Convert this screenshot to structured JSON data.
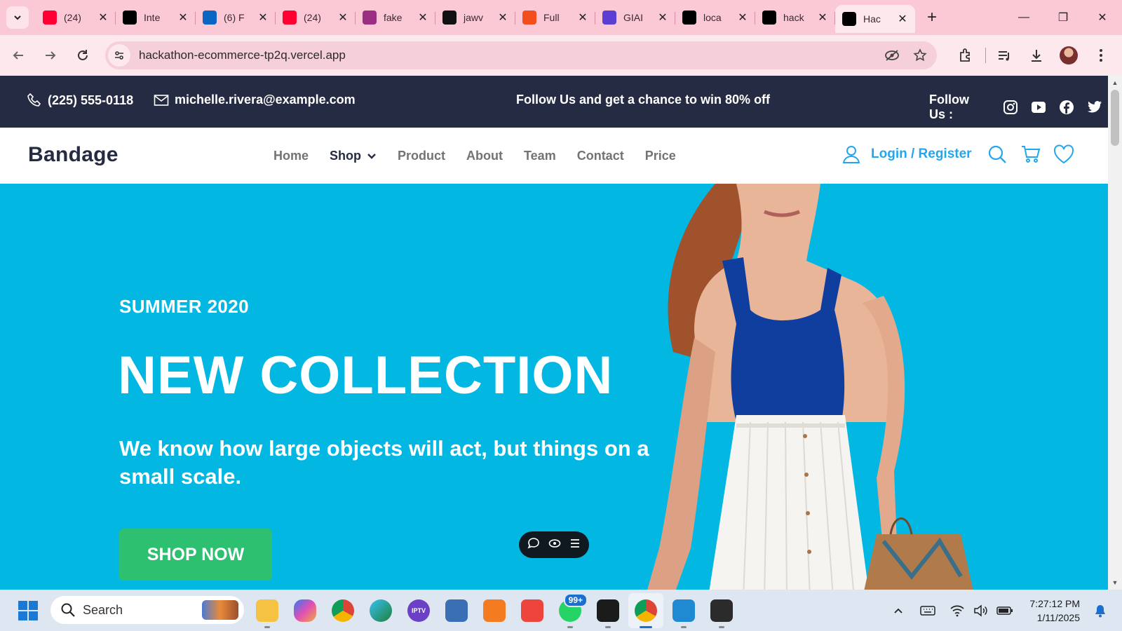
{
  "browser": {
    "tabs": [
      {
        "title": "(24)",
        "favicon": "youtube-icon",
        "color": "#ff0033"
      },
      {
        "title": "Inte",
        "favicon": "medium-icon",
        "color": "#000000"
      },
      {
        "title": "(6) F",
        "favicon": "linkedin-icon",
        "color": "#0a66c2"
      },
      {
        "title": "(24)",
        "favicon": "youtube-icon",
        "color": "#ff0033"
      },
      {
        "title": "fake",
        "favicon": "generic-app-icon",
        "color": "#9b2d82"
      },
      {
        "title": "jawv",
        "favicon": "github-icon",
        "color": "#111111"
      },
      {
        "title": "Full",
        "favicon": "figma-icon",
        "color": "#f24e1e"
      },
      {
        "title": "GIAI",
        "favicon": "forms-icon",
        "color": "#5b3fd4"
      },
      {
        "title": "loca",
        "favicon": "vercel-icon",
        "color": "#000000"
      },
      {
        "title": "hack",
        "favicon": "vercel-icon",
        "color": "#000000"
      },
      {
        "title": "Hac",
        "favicon": "vercel-icon",
        "color": "#000000"
      }
    ],
    "url": "hackathon-ecommerce-tp2q.vercel.app"
  },
  "topbar": {
    "phone": "(225) 555-0118",
    "email": "michelle.rivera@example.com",
    "promo": "Follow Us  and get a chance to win 80% off",
    "follow_label": "Follow Us  :"
  },
  "navbar": {
    "brand": "Bandage",
    "menu": [
      "Home",
      "Shop",
      "Product",
      "About",
      "Team",
      "Contact",
      "Price"
    ],
    "login": "Login / Register"
  },
  "hero": {
    "season": "SUMMER 2020",
    "title": "NEW COLLECTION",
    "text": "We know how large objects will act, but things on a small scale.",
    "cta": "SHOP NOW",
    "bg_color": "#02b8e3"
  },
  "taskbar": {
    "search_placeholder": "Search",
    "whatsapp_badge": "99+",
    "time": "7:27:12 PM",
    "date": "1/11/2025"
  }
}
